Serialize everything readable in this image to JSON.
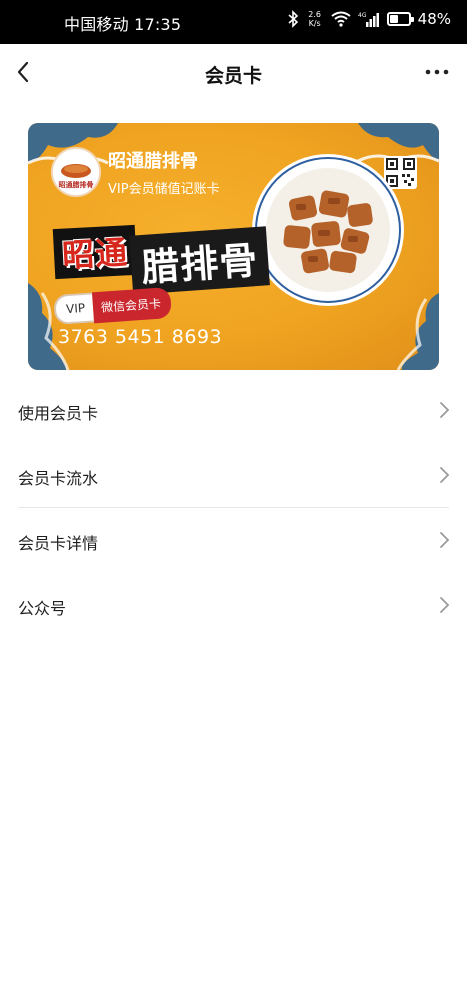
{
  "status_bar": {
    "carrier_time": "中国移动 17:35",
    "net_speed_top": "2.6",
    "net_speed_bottom": "K/s",
    "battery_percent": "48%",
    "battery_level": 0.48,
    "icons": [
      "bluetooth-icon",
      "wifi-icon",
      "signal-4g-icon",
      "battery-icon"
    ]
  },
  "nav": {
    "title": "会员卡",
    "back_icon": "chevron-left-icon",
    "more_icon": "more-dots-icon"
  },
  "card": {
    "store_name": "昭通腊排骨",
    "subtitle": "VIP会员储值记账卡",
    "logo_text": "昭通腊排骨",
    "big_title_left": "昭通",
    "big_title_right": "腊排骨",
    "vip_label": "VIP",
    "wechat_card_label": "微信会员卡",
    "card_number": "3763 5451 8693",
    "colors": {
      "background": "#efa321",
      "accent_red": "#c9262d",
      "pattern_blue": "#3f6a8a"
    }
  },
  "menu": {
    "items": [
      {
        "label": "使用会员卡"
      },
      {
        "label": "会员卡流水"
      },
      {
        "label": "会员卡详情"
      },
      {
        "label": "公众号"
      }
    ]
  }
}
